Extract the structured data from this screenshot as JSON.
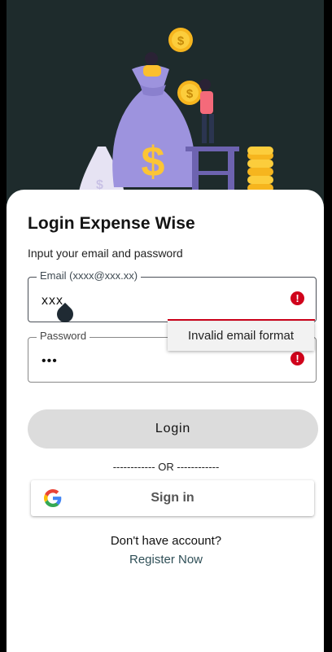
{
  "login": {
    "title": "Login Expense Wise",
    "subtitle": "Input your email and password"
  },
  "email_field": {
    "label": "Email (xxxx@xxx.xx)",
    "value": "xxx",
    "error_icon": "alert-circle-icon",
    "error_tooltip": "Invalid email format"
  },
  "password_field": {
    "label": "Password",
    "value": "•••",
    "error_icon": "alert-circle-icon"
  },
  "buttons": {
    "login_label": "Login",
    "divider": "------------ OR ------------",
    "google_label": "Sign in",
    "google_icon": "google-icon"
  },
  "footer": {
    "no_account": "Don't have account?",
    "register": "Register Now"
  },
  "colors": {
    "hero_bg": "#1e2b2c",
    "error": "#d0021b",
    "login_button": "#dcdcdc",
    "link": "#2f4f57"
  }
}
